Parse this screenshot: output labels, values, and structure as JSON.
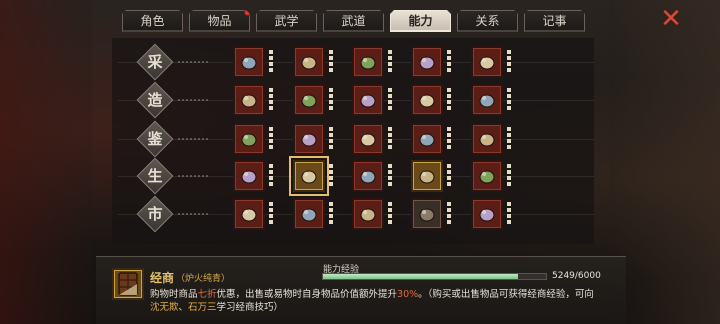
{
  "tabs": [
    {
      "label": "角色",
      "active": false,
      "badge": false
    },
    {
      "label": "物品",
      "active": false,
      "badge": true
    },
    {
      "label": "武学",
      "active": false,
      "badge": false
    },
    {
      "label": "武道",
      "active": false,
      "badge": false
    },
    {
      "label": "能力",
      "active": true,
      "badge": false
    },
    {
      "label": "关系",
      "active": false,
      "badge": false
    },
    {
      "label": "记事",
      "active": false,
      "badge": false
    }
  ],
  "close_icon": "close-x-icon",
  "rows": [
    {
      "label": "采",
      "items": [
        {
          "icon": "ore-pile-icon"
        },
        {
          "icon": "hammer-rock-icon"
        },
        {
          "icon": "basket-icon"
        },
        {
          "icon": "pickaxe-icon"
        },
        {
          "icon": "rope-coil-icon"
        }
      ]
    },
    {
      "label": "造",
      "items": [
        {
          "icon": "anvil-icon"
        },
        {
          "icon": "armor-icon"
        },
        {
          "icon": "herbs-icon"
        },
        {
          "icon": "alchemy-flask-icon"
        },
        {
          "icon": "gems-icon"
        }
      ]
    },
    {
      "label": "鉴",
      "items": [
        {
          "icon": "book-scroll-icon"
        },
        {
          "icon": "magnifier-icon"
        },
        {
          "icon": "magnifier-stand-icon"
        },
        {
          "icon": "jade-bowl-icon"
        },
        {
          "icon": "lens-book-icon"
        }
      ]
    },
    {
      "label": "生",
      "items": [
        {
          "icon": "food-bowl-icon"
        },
        {
          "icon": "chocolate-bar-icon",
          "gold": true,
          "selected": true
        },
        {
          "icon": "ring-pot-icon"
        },
        {
          "icon": "map-scroll-icon",
          "gold": true
        },
        {
          "icon": "whip-coil-icon"
        }
      ]
    },
    {
      "label": "市",
      "items": [
        {
          "icon": "money-bag-icon"
        },
        {
          "icon": "hand-give-icon"
        },
        {
          "icon": "teapot-icon"
        },
        {
          "icon": "gear-locked-icon",
          "locked": true
        },
        {
          "icon": "horn-icon"
        }
      ]
    }
  ],
  "info": {
    "icon": "chocolate-bar-icon",
    "skill_name": "经商",
    "skill_sub": "（炉火纯青）",
    "exp_label": "能力经验",
    "exp_current": 5249,
    "exp_max": 6000,
    "exp_text": "5249/6000",
    "desc1_a": "购物时商品",
    "desc1_hl1": "七折",
    "desc1_b": "优惠，出售或易物时自身物品价值额外提升",
    "desc1_hl2": "30%",
    "desc1_c": "。（购买或出售物品可获得经商经验，可向",
    "desc2_hl1": "沈无欺",
    "desc2_a": "、",
    "desc2_hl2": "石万三",
    "desc2_b": "学习经商技巧）"
  },
  "colors": {
    "slot_red": "#5a1e17",
    "slot_gold": "#6a4a18",
    "exp_fill": "#9bd6a2",
    "accent_orange": "#e06a44",
    "close_red": "#d44a3c"
  }
}
